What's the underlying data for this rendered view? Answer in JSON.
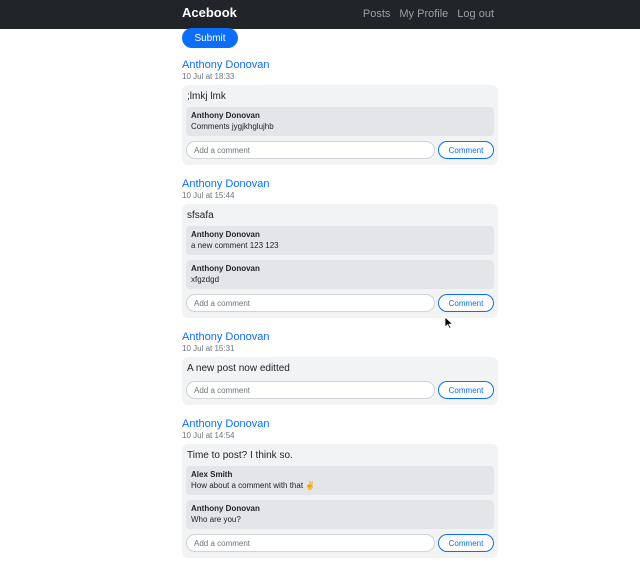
{
  "navbar": {
    "brand": "Acebook",
    "links": [
      "Posts",
      "My Profile",
      "Log out"
    ]
  },
  "submit_label": "Submit",
  "comment_button_label": "Comment",
  "comment_placeholder": "Add a comment",
  "posts": [
    {
      "author": "Anthony Donovan",
      "time": "10 Jul at 18:33",
      "body": ";lmkj lmk",
      "comments": [
        {
          "author": "Anthony Donovan",
          "text": "Comments jygjkhglujhb"
        }
      ]
    },
    {
      "author": "Anthony Donovan",
      "time": "10 Jul at 15:44",
      "body": "sfsafa",
      "comments": [
        {
          "author": "Anthony Donovan",
          "text": "a new comment 123 123"
        },
        {
          "author": "Anthony Donovan",
          "text": "xfgzdgd"
        }
      ]
    },
    {
      "author": "Anthony Donovan",
      "time": "10 Jul at 15:31",
      "body": "A new post now editted",
      "comments": []
    },
    {
      "author": "Anthony Donovan",
      "time": "10 Jul at 14:54",
      "body": "Time to post? I think so.",
      "comments": [
        {
          "author": "Alex Smith",
          "text": "How about a comment with that ✌️"
        },
        {
          "author": "Anthony Donovan",
          "text": "Who are you?"
        }
      ]
    }
  ]
}
